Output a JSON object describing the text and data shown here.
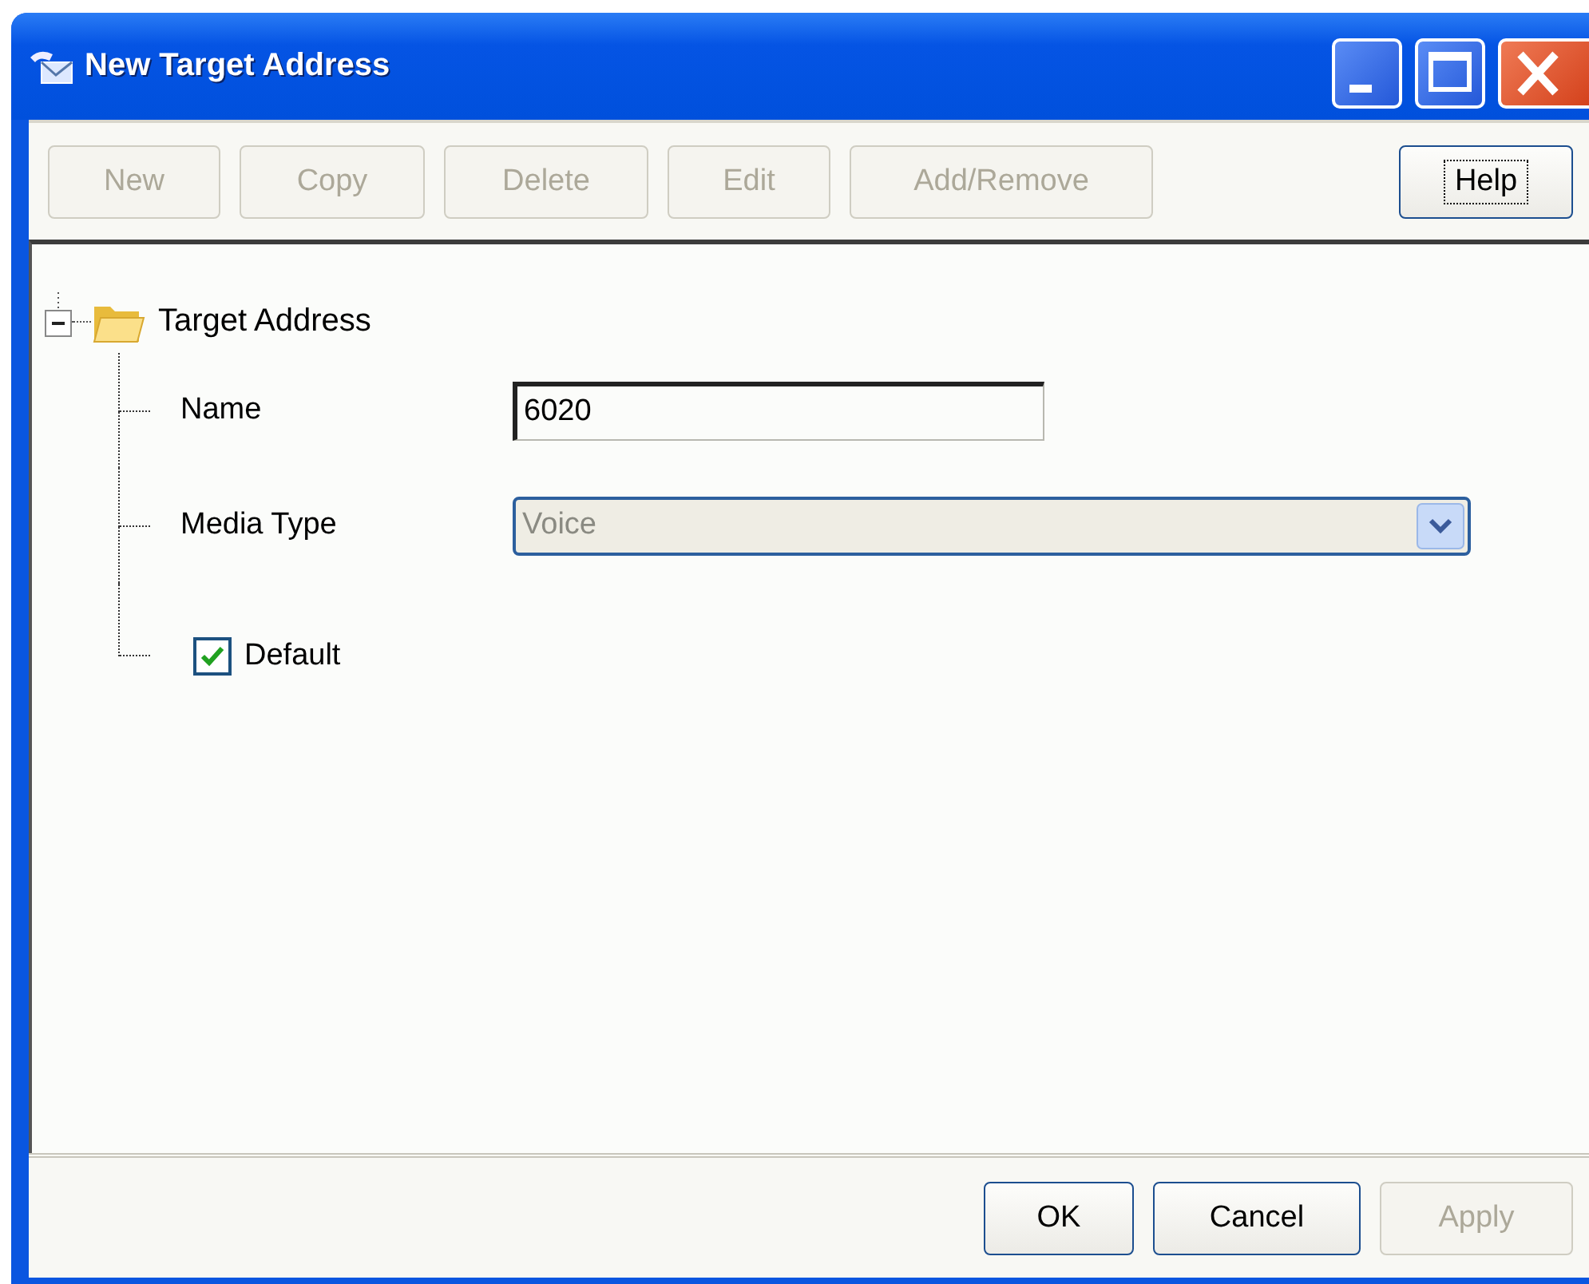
{
  "window": {
    "title": "New Target Address"
  },
  "toolbar": {
    "buttons": [
      {
        "label": "New",
        "disabled": true,
        "focused": false
      },
      {
        "label": "Copy",
        "disabled": true,
        "focused": false
      },
      {
        "label": "Delete",
        "disabled": true,
        "focused": false
      },
      {
        "label": "Edit",
        "disabled": true,
        "focused": false
      },
      {
        "label": "Add/Remove",
        "disabled": true,
        "focused": false
      },
      {
        "label": "Help",
        "disabled": false,
        "focused": true
      }
    ]
  },
  "tree": {
    "root": {
      "label": "Target Address",
      "expanded": true,
      "children": [
        {
          "kind": "text",
          "label": "Name",
          "value": "6020"
        },
        {
          "kind": "select",
          "label": "Media Type",
          "value": "Voice",
          "disabled": true
        },
        {
          "kind": "checkbox",
          "label": "Default",
          "checked": true
        }
      ]
    }
  },
  "footer": {
    "buttons": [
      {
        "label": "OK",
        "disabled": false,
        "focused": false
      },
      {
        "label": "Cancel",
        "disabled": false,
        "focused": false
      },
      {
        "label": "Apply",
        "disabled": true,
        "focused": false
      }
    ]
  }
}
